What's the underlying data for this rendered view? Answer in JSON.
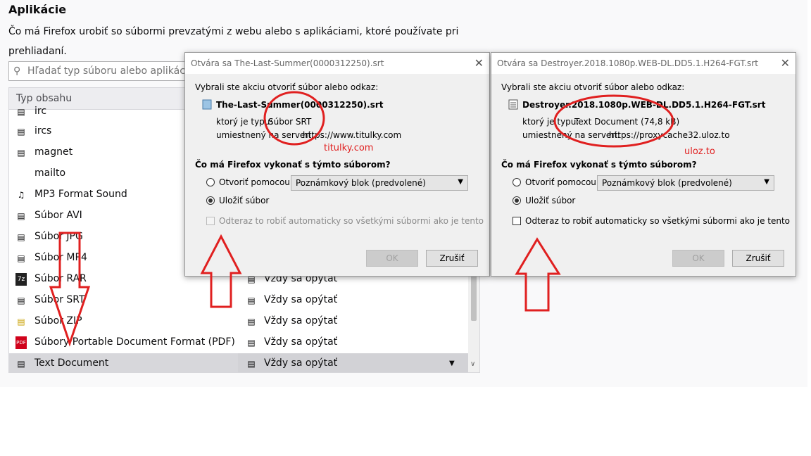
{
  "settings": {
    "title": "Aplikácie",
    "description": "Čo má Firefox urobiť so súbormi prevzatými z webu alebo s aplikáciami, ktoré používate pri prehliadaní.",
    "search_placeholder": "Hľadať typ súboru alebo aplikácie",
    "column_content_type": "Typ obsahu"
  },
  "rows": [
    {
      "name": "irc",
      "icon": "generic-type-icon",
      "action": ""
    },
    {
      "name": "ircs",
      "icon": "generic-type-icon",
      "action": ""
    },
    {
      "name": "magnet",
      "icon": "generic-type-icon",
      "action": ""
    },
    {
      "name": "mailto",
      "icon": "",
      "action": ""
    },
    {
      "name": "MP3 Format Sound",
      "icon": "music-file-icon",
      "action": ""
    },
    {
      "name": "Súbor AVI",
      "icon": "video-file-icon",
      "action": ""
    },
    {
      "name": "Súbor JPG",
      "icon": "image-file-icon",
      "action": ""
    },
    {
      "name": "Súbor MP4",
      "icon": "video-file-icon",
      "action": ""
    },
    {
      "name": "Súbor RAR",
      "icon": "archive-file-icon",
      "action": "Vždy sa opýtať"
    },
    {
      "name": "Súbor SRT",
      "icon": "text-file-icon",
      "action": "Vždy sa opýtať"
    },
    {
      "name": "Súbor ZIP",
      "icon": "zip-file-icon",
      "action": "Vždy sa opýtať"
    },
    {
      "name": "Súbory Portable Document Format (PDF)",
      "icon": "pdf-file-icon",
      "action": "Vždy sa opýtať"
    },
    {
      "name": "Text Document",
      "icon": "text-file-icon",
      "action": "Vždy sa opýtať"
    }
  ],
  "dialogs": [
    {
      "title": "Otvára sa The-Last-Summer(0000312250).srt",
      "lead": "Vybrali ste akciu otvoriť súbor alebo odkaz:",
      "file_name": "The-Last-Summer(0000312250).srt",
      "type_label": "ktorý je typu:",
      "type_value": "Súbor SRT",
      "server_label": "umiestnený na serveri:",
      "server_value": "https://www.titulky.com",
      "question": "Čo má Firefox vykonať s týmto súborom?",
      "open_with_label": "Otvoriť pomocou",
      "app_value": "Poznámkový blok (predvolené)",
      "save_label": "Uložiť súbor",
      "auto_label": "Odteraz to robiť automaticky so všetkými súbormi ako je tento",
      "ok_label": "OK",
      "cancel_label": "Zrušiť",
      "annotation": "titulky.com"
    },
    {
      "title": "Otvára sa Destroyer.2018.1080p.WEB-DL.DD5.1.H264-FGT.srt",
      "lead": "Vybrali ste akciu otvoriť súbor alebo odkaz:",
      "file_name": "Destroyer.2018.1080p.WEB-DL.DD5.1.H264-FGT.srt",
      "type_label": "ktorý je typu:",
      "type_value": "Text Document (74,8 kB)",
      "server_label": "umiestnený na serveri:",
      "server_value": "https://proxycache32.uloz.to",
      "question": "Čo má Firefox vykonať s týmto súborom?",
      "open_with_label": "Otvoriť pomocou",
      "app_value": "Poznámkový blok (predvolené)",
      "save_label": "Uložiť súbor",
      "auto_label": "Odteraz to robiť automaticky so všetkými súbormi ako je tento",
      "ok_label": "OK",
      "cancel_label": "Zrušiť",
      "annotation": "uloz.to"
    }
  ],
  "colors": {
    "annotation": "#e02020",
    "bg": "#f9f9fa"
  }
}
